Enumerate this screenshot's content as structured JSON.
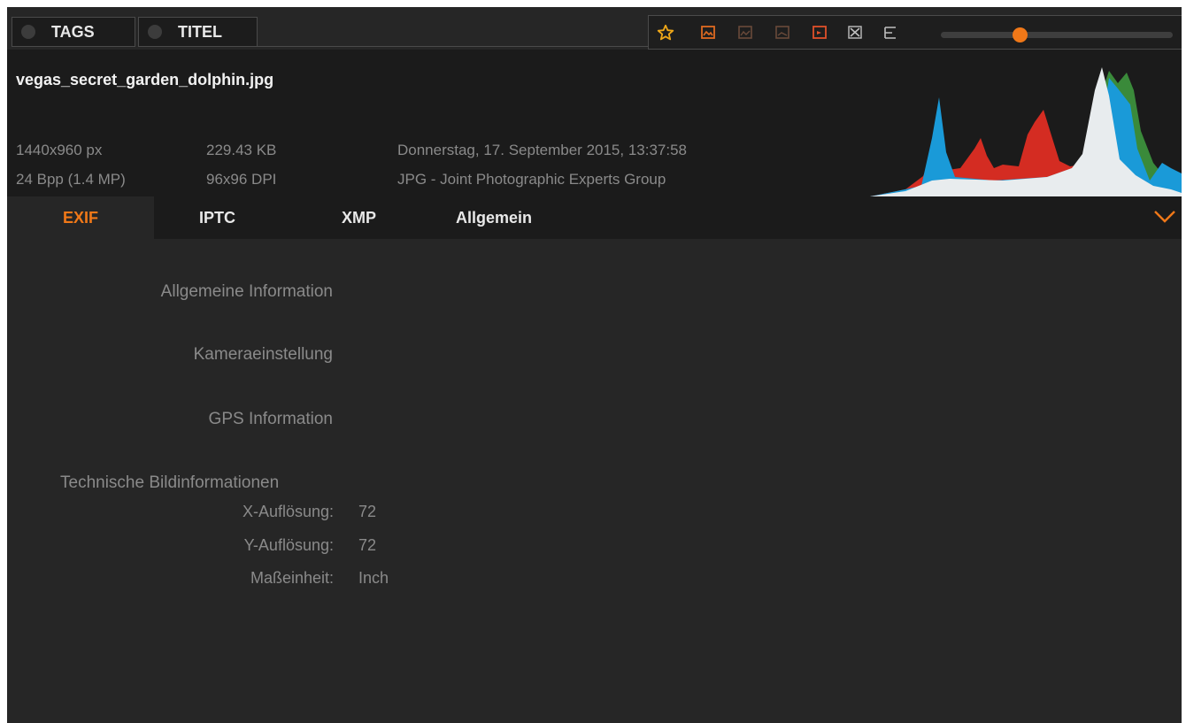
{
  "top_tabs": [
    {
      "label": "TAGS"
    },
    {
      "label": "TITEL"
    }
  ],
  "toolbar": {
    "icons": [
      "star-icon",
      "image-edit-icon",
      "image-edit-dim-icon",
      "image-edit-dim2-icon",
      "image-compare-icon",
      "close-x-icon",
      "flow-icon"
    ],
    "slider_value": 0.33,
    "accent_color": "#f07818"
  },
  "file": {
    "name": "vegas_secret_garden_dolphin.jpg",
    "dimensions": "1440x960 px",
    "bpp": "24 Bpp (1.4 MP)",
    "size": "229.43 KB",
    "dpi": "96x96 DPI",
    "date": "Donnerstag, 17. September 2015, 13:37:58",
    "format": "JPG - Joint Photographic Experts Group"
  },
  "histogram": {
    "colors": {
      "red": "#d42c22",
      "green": "#3a8a3a",
      "blue": "#1a9ad8",
      "luminance": "#e8ecee"
    }
  },
  "tabs": [
    {
      "label": "EXIF",
      "active": true
    },
    {
      "label": "IPTC",
      "active": false
    },
    {
      "label": "XMP",
      "active": false
    },
    {
      "label": "Allgemein",
      "active": false
    }
  ],
  "sections": {
    "general": "Allgemeine Information",
    "camera": "Kameraeinstellung",
    "gps": "GPS Information",
    "technical": "Technische Bildinformationen"
  },
  "technical_fields": [
    {
      "label": "X-Auflösung:",
      "value": "72"
    },
    {
      "label": "Y-Auflösung:",
      "value": "72"
    },
    {
      "label": "Maßeinheit:",
      "value": "Inch"
    }
  ]
}
